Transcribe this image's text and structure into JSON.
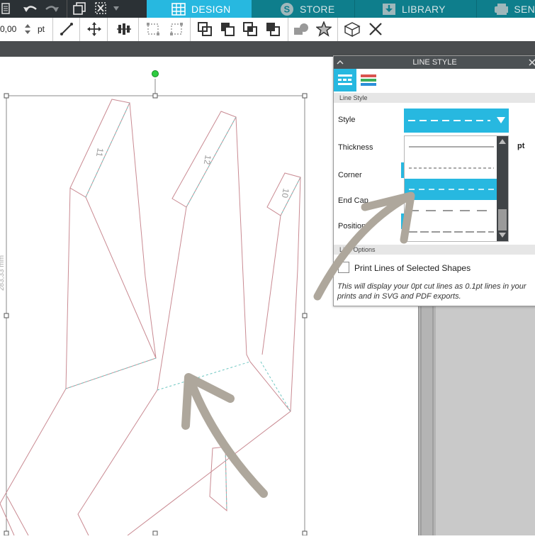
{
  "topbar": {
    "tabs": [
      {
        "label": "DESIGN",
        "icon": "grid-icon",
        "active": true
      },
      {
        "label": "STORE",
        "icon": "store-s-icon",
        "active": false
      },
      {
        "label": "LIBRARY",
        "icon": "library-download-icon",
        "active": false
      },
      {
        "label": "SEN",
        "icon": "send-machine-icon",
        "active": false
      }
    ],
    "colors": {
      "bar": "#2b3135",
      "active_tab": "#27b8e0",
      "inactive_tab": "#0e7e8c"
    }
  },
  "toolbar": {
    "value": "0,00",
    "unit": "pt",
    "icons": [
      "line-icon",
      "move-icon",
      "align-icon",
      "group-icon",
      "ungroup-icon",
      "weld-icon",
      "subtract-icon",
      "intersect-icon",
      "crop-icon",
      "shape-fill-icon",
      "star-icon",
      "3d-box-icon",
      "close-icon"
    ]
  },
  "canvas": {
    "ruler_text": "283,33 mm",
    "piece_labels": [
      "11",
      "12",
      "10"
    ],
    "cut_line_color": "#c98a92",
    "score_line_color": "#6fc7c2"
  },
  "panel": {
    "title": "LINE STYLE",
    "section_line_style": "Line Style",
    "labels": {
      "style": "Style",
      "thickness": "Thickness",
      "corner": "Corner",
      "end_cap": "End Cap",
      "position": "Position"
    },
    "thickness_unit": "pt",
    "section_line_options": "Line Options",
    "checkbox_label": "Print Lines of Selected Shapes",
    "checkbox_checked": false,
    "note": "This will display your 0pt cut lines as 0.1pt lines in your prints and in SVG and PDF exports.",
    "dash_styles": [
      "solid",
      "dashed-fine",
      "dashed-selected",
      "dash-long",
      "dash-medium"
    ],
    "selected_style_index": 2,
    "accent": "#27b8e0"
  }
}
